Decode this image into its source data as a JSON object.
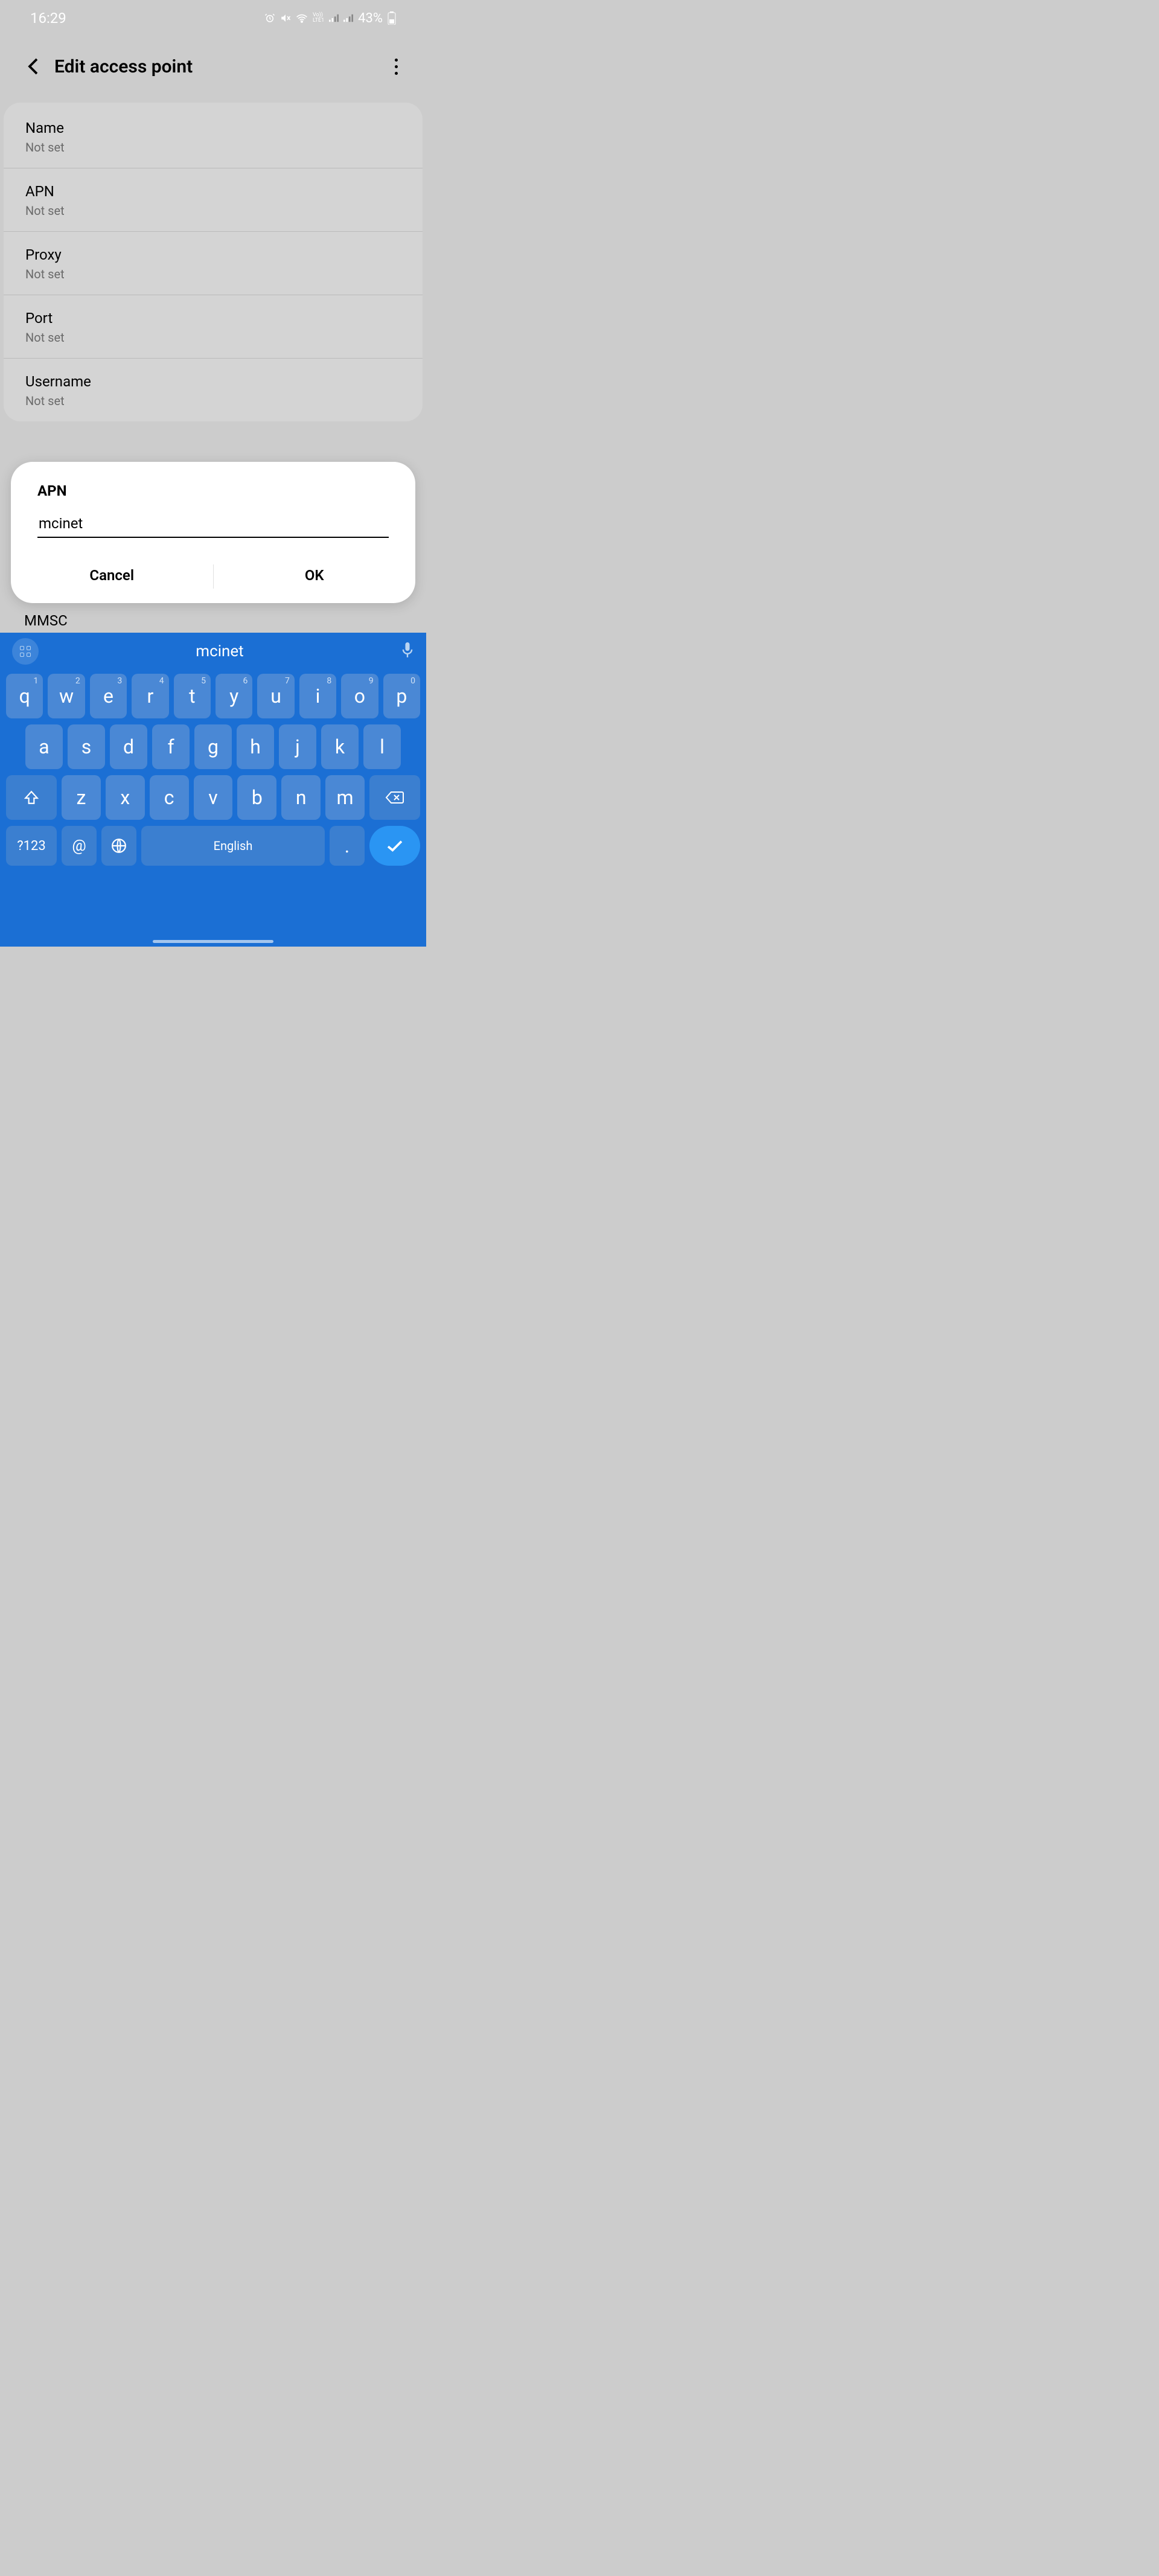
{
  "status": {
    "time": "16:29",
    "battery": "43%"
  },
  "header": {
    "title": "Edit access point"
  },
  "settings": [
    {
      "label": "Name",
      "value": "Not set"
    },
    {
      "label": "APN",
      "value": "Not set"
    },
    {
      "label": "Proxy",
      "value": "Not set"
    },
    {
      "label": "Port",
      "value": "Not set"
    },
    {
      "label": "Username",
      "value": "Not set"
    }
  ],
  "dialog": {
    "title": "APN",
    "input_value": "mcinet",
    "cancel": "Cancel",
    "ok": "OK"
  },
  "peek": {
    "mmsc": "MMSC"
  },
  "keyboard": {
    "suggestion": "mcinet",
    "row1": [
      {
        "k": "q",
        "n": "1"
      },
      {
        "k": "w",
        "n": "2"
      },
      {
        "k": "e",
        "n": "3"
      },
      {
        "k": "r",
        "n": "4"
      },
      {
        "k": "t",
        "n": "5"
      },
      {
        "k": "y",
        "n": "6"
      },
      {
        "k": "u",
        "n": "7"
      },
      {
        "k": "i",
        "n": "8"
      },
      {
        "k": "o",
        "n": "9"
      },
      {
        "k": "p",
        "n": "0"
      }
    ],
    "row2": [
      "a",
      "s",
      "d",
      "f",
      "g",
      "h",
      "j",
      "k",
      "l"
    ],
    "row3": [
      "z",
      "x",
      "c",
      "v",
      "b",
      "n",
      "m"
    ],
    "sym": "?123",
    "at": "@",
    "space": "English",
    "dot": "."
  }
}
